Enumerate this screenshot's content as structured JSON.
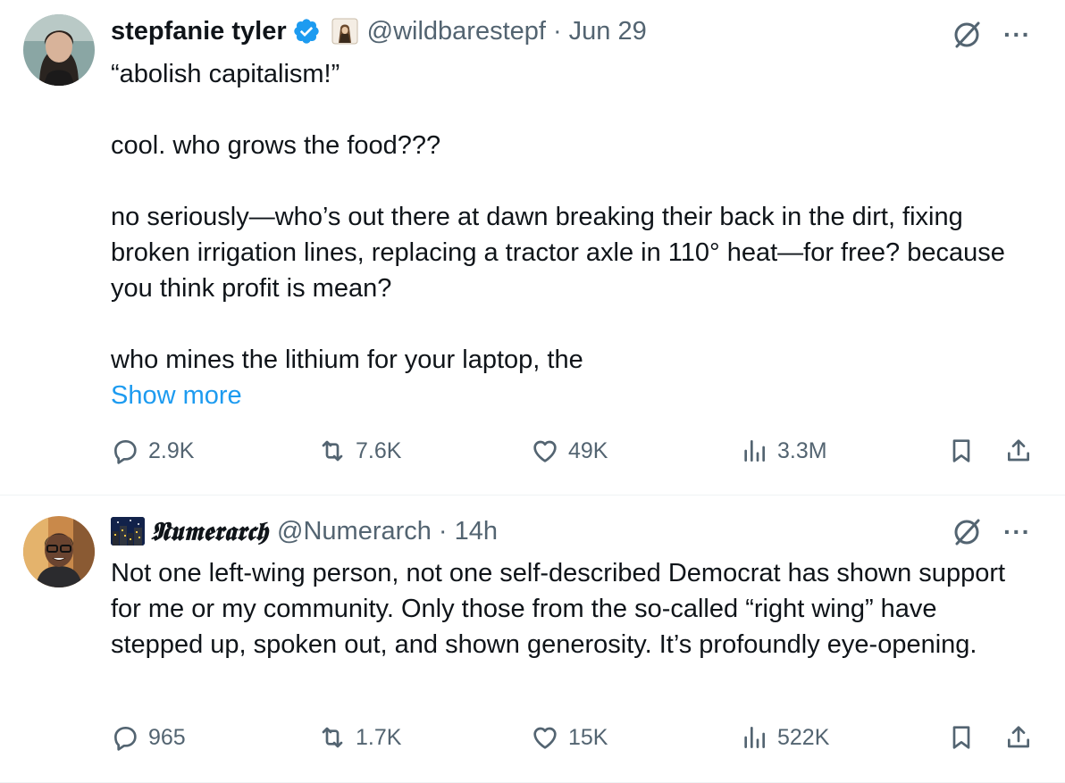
{
  "tweets": [
    {
      "display_name": "stepfanie tyler",
      "handle": "@wildbarestepf",
      "separator": "·",
      "time": "Jun 29",
      "text": "“abolish capitalism!”\n\ncool. who grows the food???\n\nno seriously—who’s out there at dawn breaking their back in the dirt, fixing broken irrigation lines, replacing a tractor axle in 110° heat—for free? because you think profit is mean?\n\nwho mines the lithium for your laptop, the",
      "show_more": "Show more",
      "replies": "2.9K",
      "reposts": "7.6K",
      "likes": "49K",
      "views": "3.3M",
      "verified": true,
      "badge_icon": "hooded-figure-emoji-icon"
    },
    {
      "display_name": "𝕹𝖚𝖒𝖊𝖗𝖆𝖗𝖈𝖍",
      "handle": "@Numerarch",
      "separator": "·",
      "time": "14h",
      "text": "Not one left-wing person, not one self-described Democrat has shown support for me or my community. Only those from the so-called “right wing” have stepped up, spoken out, and shown generosity. It’s profoundly eye-opening.",
      "replies": "965",
      "reposts": "1.7K",
      "likes": "15K",
      "views": "522K",
      "name_emoji_icon": "night-city-emoji-icon"
    }
  ],
  "colors": {
    "text": "#0f1419",
    "secondary": "#536471",
    "link": "#1d9bf0",
    "verified": "#1d9bf0",
    "divider": "#eff3f4"
  }
}
